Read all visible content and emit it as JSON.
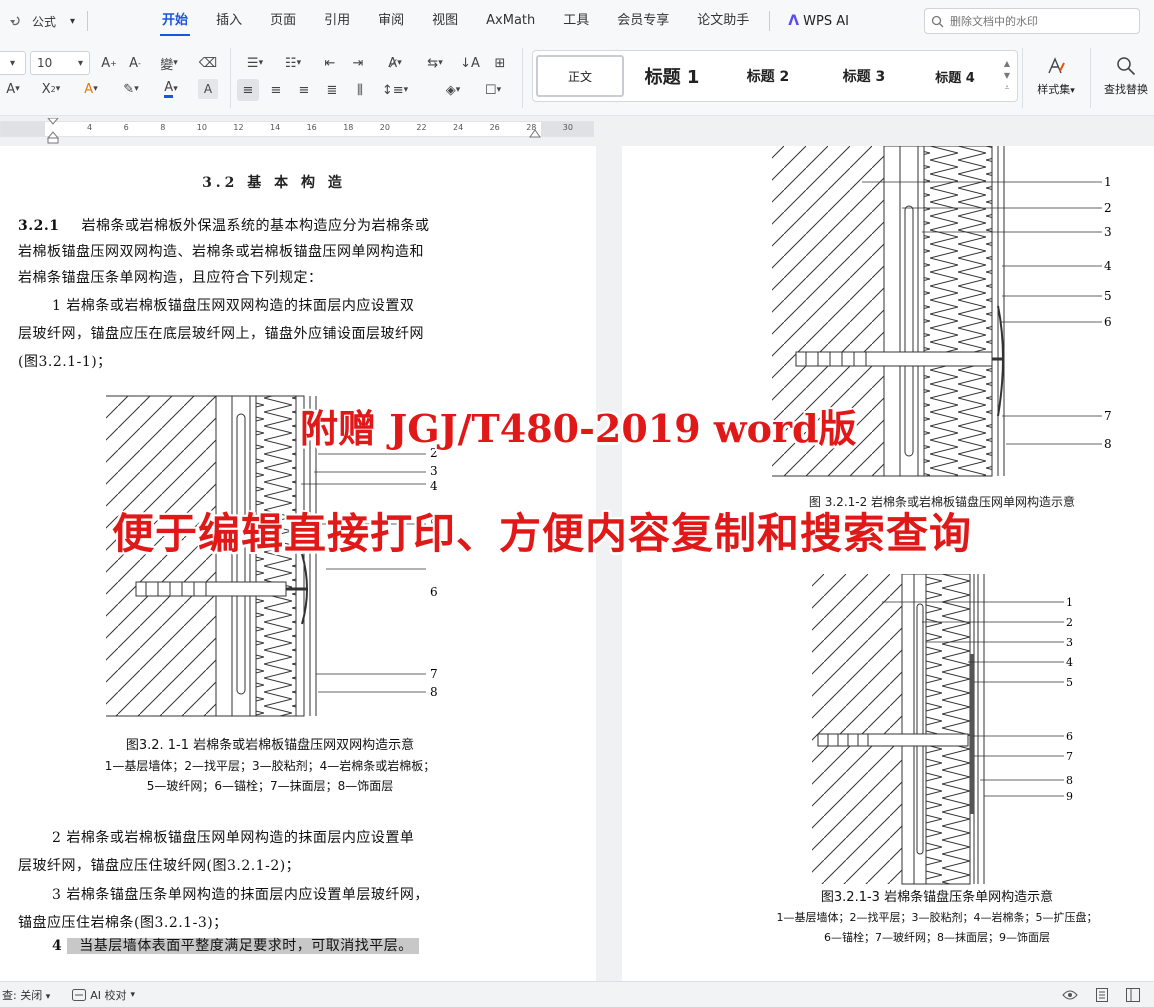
{
  "menubar": {
    "formula": "公式",
    "tabs": [
      "开始",
      "插入",
      "页面",
      "引用",
      "审阅",
      "视图",
      "AxMath",
      "工具",
      "会员专享",
      "论文助手"
    ],
    "active_tab": "开始",
    "wps_ai": "WPS AI",
    "search_placeholder": "删除文档中的水印"
  },
  "toolbar": {
    "font_size": "10",
    "styles": [
      "正文",
      "标题 1",
      "标题 2",
      "标题 3",
      "标题 4"
    ],
    "style_set": "样式集",
    "find_replace": "查找替换",
    "accent_color": "#1a56db"
  },
  "ruler": {
    "ticks": [
      "4",
      "6",
      "8",
      "10",
      "12",
      "14",
      "16",
      "18",
      "20",
      "22",
      "24",
      "26",
      "28",
      "30"
    ]
  },
  "left_page": {
    "section_title": "3.2  基 本 构 造",
    "clause_num": "3.2.1",
    "clause_lines": [
      "岩棉条或岩棉板外保温系统的基本构造应分为岩棉条或",
      "岩棉板锚盘压网双网构造、岩棉条或岩棉板锚盘压网单网构造和",
      "岩棉条锚盘压条单网构造，且应符合下列规定："
    ],
    "item1_lines": [
      "1   岩棉条或岩棉板锚盘压网双网构造的抹面层内应设置双",
      "层玻纤网，锚盘应压在底层玻纤网上，锚盘外应铺设面层玻纤网",
      "(图3.2.1-1)；"
    ],
    "fig1_labels": [
      "3",
      "4",
      "5",
      "6",
      "7",
      "8",
      "2"
    ],
    "fig1_caption": [
      "图3.2. 1-1  岩棉条或岩棉板锚盘压网双网构造示意",
      "1—基层墙体；2—找平层；3—胶粘剂；4—岩棉条或岩棉板；",
      "5—玻纤网；6—锚栓；7—抹面层；8—饰面层"
    ],
    "item2_lines": [
      "2   岩棉条或岩棉板锚盘压网单网构造的抹面层内应设置单",
      "层玻纤网，锚盘应压住玻纤网(图3.2.1-2)；"
    ],
    "item3_lines": [
      "3   岩棉条锚盘压条单网构造的抹面层内应设置单层玻纤网，",
      "锚盘应压住岩棉条(图3.2.1-3)；"
    ],
    "item4_num": "4",
    "item4_text": "当基层墙体表面平整度满足要求时，可取消找平层。"
  },
  "right_page": {
    "fig2_labels": [
      "1",
      "2",
      "3",
      "4",
      "5",
      "6",
      "7",
      "8"
    ],
    "fig2_caption_fragment": "图 3.2.1-2  岩棉条或岩棉板锚盘压网单网构造示意",
    "fig3_labels": [
      "1",
      "2",
      "3",
      "4",
      "5",
      "6",
      "7",
      "8",
      "9"
    ],
    "fig3_caption": [
      "图3.2.1-3  岩棉条锚盘压条单网构造示意",
      "1—基层墙体；2—找平层；3—胶粘剂；4—岩棉条；5—扩压盘；",
      "6—锚栓；7—玻纤网；8—抹面层；9—饰面层"
    ]
  },
  "overlay": {
    "line1": "附赠 JGJ/T480-2019 word版",
    "line2": "便于编辑直接打印、方便内容复制和搜索查询",
    "color": "#e01818"
  },
  "statusbar": {
    "review_label": "查: 关闭",
    "ai_check": "AI 校对"
  }
}
